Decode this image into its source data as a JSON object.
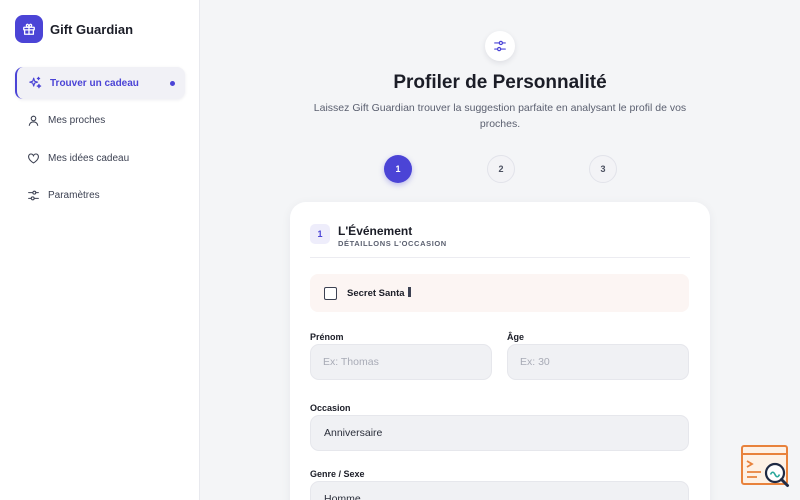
{
  "app": {
    "name": "Gift Guardian",
    "brand_color": "#4b44d6",
    "logo_icon": "gift-icon"
  },
  "sidebar": {
    "items": [
      {
        "label": "Trouver un cadeau",
        "icon": "sparkles-icon",
        "active": true
      },
      {
        "label": "Mes proches",
        "icon": "user-icon",
        "active": false
      },
      {
        "label": "Mes idées cadeau",
        "icon": "heart-icon",
        "active": false
      },
      {
        "label": "Paramètres",
        "icon": "sliders-icon",
        "active": false
      }
    ]
  },
  "header": {
    "icon": "sliders-icon",
    "title": "Profiler de Personnalité",
    "subtitle": "Laissez Gift Guardian trouver la suggestion parfaite en analysant le profil de vos proches."
  },
  "steps": [
    {
      "label": "1",
      "active": true
    },
    {
      "label": "2",
      "active": false
    },
    {
      "label": "3",
      "active": false
    }
  ],
  "card": {
    "badge": "1",
    "title": "L'Événement",
    "caption": "DÉTAILLONS L'OCCASION",
    "secret_santa": {
      "label": "Secret Santa",
      "checked": false
    },
    "fields": {
      "first_name": {
        "label": "Prénom",
        "value": "",
        "placeholder": "Ex: Thomas"
      },
      "age": {
        "label": "Âge",
        "value": "",
        "placeholder": "Ex: 30"
      },
      "occasion": {
        "label": "Occasion",
        "value": "Anniversaire"
      },
      "gender": {
        "label": "Genre / Sexe",
        "value": "Homme"
      }
    }
  },
  "floating_widget": {
    "icon": "search-inspect-icon",
    "color": "#e8823c"
  }
}
